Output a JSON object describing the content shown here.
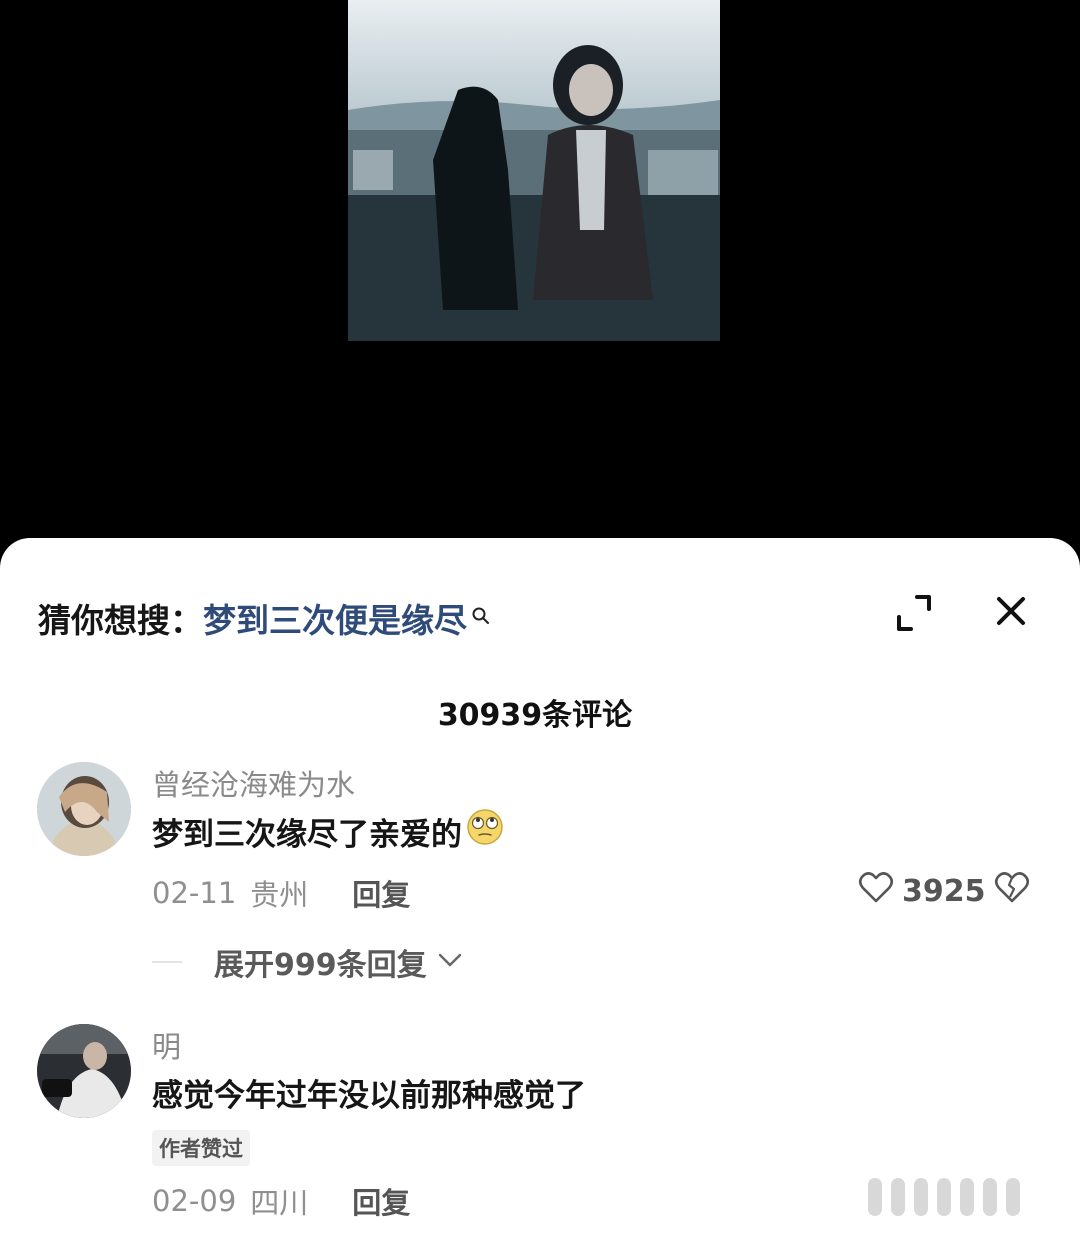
{
  "suggest": {
    "prefix": "猜你想搜：",
    "term": "梦到三次便是缘尽"
  },
  "comments_header": {
    "count_label": "30939条评论"
  },
  "comments": [
    {
      "username": "曾经沧海难为水",
      "text": "梦到三次缘尽了亲爱的",
      "emoji": "eye-roll-emoji",
      "date": "02-11",
      "location": "贵州",
      "reply_label": "回复",
      "like_count": "3925",
      "expand_label": "展开999条回复"
    },
    {
      "username": "明",
      "text": "感觉今年过年没以前那种感觉了",
      "badge": "作者赞过",
      "date": "02-09",
      "location": "四川",
      "reply_label": "回复"
    }
  ],
  "icons": {
    "search": "search-icon",
    "expand": "expand-icon",
    "close": "close-icon",
    "like": "heart-icon",
    "dislike": "broken-heart-icon",
    "chevron": "chevron-down-icon"
  },
  "colors": {
    "background_video": "#000000",
    "sheet": "#ffffff",
    "suggest_term": "#2f4b7a",
    "text_primary": "#161616",
    "text_secondary": "#8f8f8f"
  }
}
